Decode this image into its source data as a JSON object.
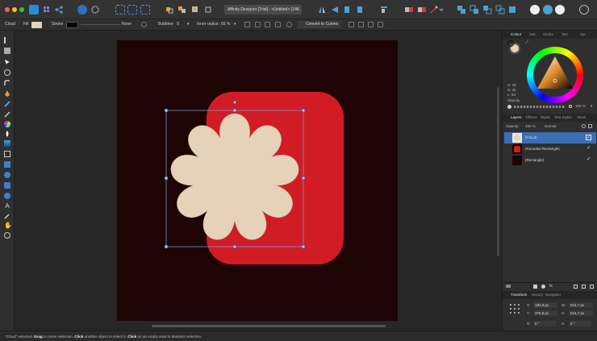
{
  "window": {
    "document_title": "Affinity Designer [Trial] - <Untitled> (146.",
    "close_glyph": "×"
  },
  "context_toolbar": {
    "object_type": "Cloud",
    "fill_label": "Fill",
    "fill_color": "#e6d2b9",
    "stroke_label": "Stroke",
    "stroke_color": "#000000",
    "stroke_none_label": "None",
    "bubbles_label": "Bubbles:",
    "bubbles_value": "9",
    "inner_radius_label": "Inner radius:",
    "inner_radius_value": "66 %",
    "convert_button": "Convert to Curves"
  },
  "canvas": {
    "artboard_color": "#1e0404",
    "rounded_rect_color": "#d11c26",
    "cloud_color": "#e6d2b9",
    "selection_color": "#6f9ad6"
  },
  "colour_panel": {
    "tabs": [
      "Colour",
      "Swt",
      "Stroke",
      "Brs",
      "Apr"
    ],
    "active_tab": "Colour",
    "h_label": "H: 36",
    "s_label": "S: 45",
    "l_label": "L: 63",
    "opacity_label": "Opacity",
    "opacity_value": "100 %"
  },
  "layers_panel": {
    "tabs": [
      "Layers",
      "Effects",
      "Styles",
      "Text Styles",
      "Stock"
    ],
    "active_tab": "Layers",
    "opacity_label": "Opacity:",
    "opacity_value": "100 %",
    "blend_mode": "Normal",
    "layers": [
      {
        "name": "(Cloud)",
        "selected": true,
        "visible_mark": "✓"
      },
      {
        "name": "(Rounded Rectangle)",
        "selected": false,
        "visible_mark": "✓"
      },
      {
        "name": "(Rectangle)",
        "selected": false,
        "visible_mark": "✓"
      }
    ]
  },
  "transform_panel": {
    "tabs": [
      "Transform",
      "History",
      "Navigator"
    ],
    "active_tab": "Transform",
    "x_label": "X:",
    "x_value": "192,9 px",
    "y_label": "Y:",
    "y_value": "375,8 px",
    "w_label": "W:",
    "w_value": "524,7 px",
    "h_label": "H:",
    "h_value": "524,7 px",
    "r_label": "R:",
    "r_value": "0 °",
    "s_label": "S:",
    "s_value": "0 °"
  },
  "status_bar": {
    "object": "\"Cloud\" selected.",
    "drag": "Drag",
    "drag_text": "to move selection.",
    "click": "Click",
    "click_text": "another object to select it.",
    "click2": "Click",
    "click2_text": "on an empty area to deselect selection."
  }
}
